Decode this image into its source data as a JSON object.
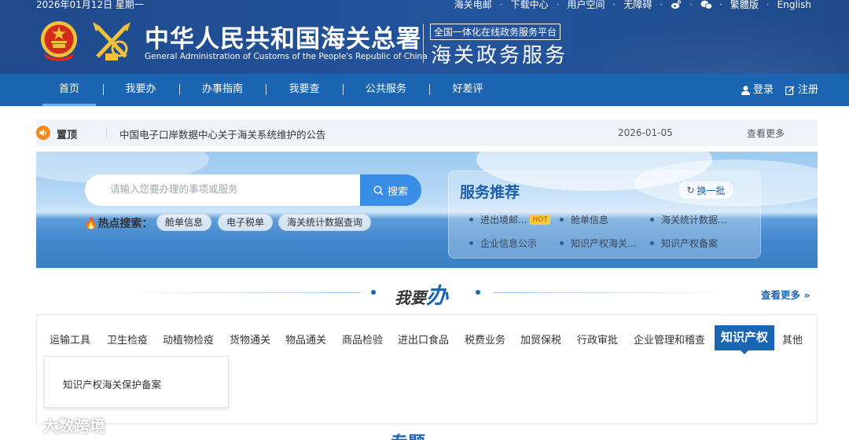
{
  "header": {
    "date": "2026年01月12日 星期一",
    "top_links": [
      "海关电邮",
      "下载中心",
      "用户空间",
      "无障碍"
    ],
    "weibo_icon": "weibo-icon",
    "wechat_icon": "wechat-icon",
    "lang_links": [
      "繁體版",
      "English"
    ],
    "title_cn": "中华人民共和国海关总署",
    "title_en": "General Administration of Customs of the People's Republic of China",
    "platform_tag": "全国一体化在线政务服务平台",
    "platform_name": "海关政务服务"
  },
  "nav": {
    "items": [
      "首页",
      "我要办",
      "办事指南",
      "我要查",
      "公共服务",
      "好差评"
    ],
    "active_index": 0,
    "login": "登录",
    "register": "注册"
  },
  "notice": {
    "label": "置顶",
    "text": "中国电子口岸数据中心关于海关系统维护的公告",
    "date": "2026-01-05",
    "more": "查看更多"
  },
  "search": {
    "placeholder": "请输入您要办理的事项或服务",
    "button": "搜索",
    "hot_label": "热点搜索：",
    "hot_tags": [
      "舱单信息",
      "电子税单",
      "海关统计数据查询"
    ]
  },
  "recommend": {
    "title": "服务推荐",
    "switch": "换一批",
    "items": [
      "进出境邮...",
      "舱单信息",
      "海关统计数据...",
      "企业信息公示",
      "知识产权海关...",
      "知识产权备案"
    ],
    "hot_badge": "HOT"
  },
  "section": {
    "title_part1": "我要",
    "title_part2": "办",
    "more": "查看更多"
  },
  "categories": {
    "tabs": [
      "运输工具",
      "卫生检疫",
      "动植物检疫",
      "货物通关",
      "物品通关",
      "商品检验",
      "进出口食品",
      "税费业务",
      "加贸保税",
      "行政审批",
      "企业管理和稽查",
      "知识产权",
      "其他"
    ],
    "active_index": 11,
    "sub_items": [
      "知识产权海关保护备案"
    ]
  },
  "next_section_title": "专题",
  "watermark": "大数跨境",
  "colors": {
    "header_bg": "#24549c",
    "nav_bg": "#1c65b3",
    "accent": "#1c65b3",
    "search_btn": "#3a8ee6",
    "hot_badge": "#ffc83d",
    "speaker": "#f28a1e"
  }
}
